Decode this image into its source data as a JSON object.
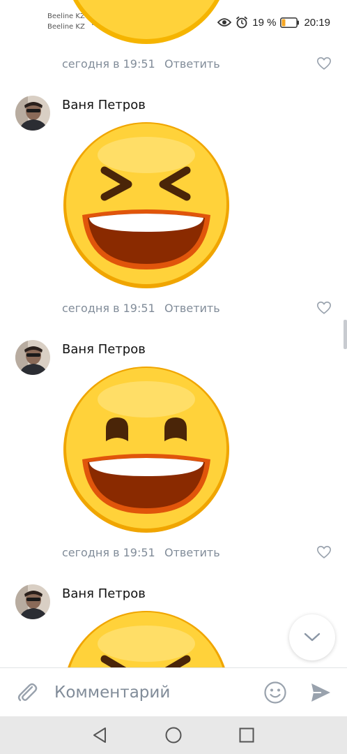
{
  "status_bar": {
    "carrier_1": "Beeline KZ",
    "carrier_2": "Beeline KZ",
    "battery": "19 %",
    "time": "20:19"
  },
  "comments": [
    {
      "author": "",
      "time": "сегодня в 19:51",
      "reply_label": "Ответить",
      "sticker": "grinning-face"
    },
    {
      "author": "Ваня Петров",
      "time": "сегодня в 19:51",
      "reply_label": "Ответить",
      "sticker": "laughing-squint-face"
    },
    {
      "author": "Ваня Петров",
      "time": "сегодня в 19:51",
      "reply_label": "Ответить",
      "sticker": "grinning-smiling-eyes-face"
    },
    {
      "author": "Ваня Петров",
      "time": "",
      "reply_label": "",
      "sticker": "laughing-squint-face"
    }
  ],
  "input_bar": {
    "placeholder": "Комментарий"
  },
  "colors": {
    "accent": "#5181b8",
    "meta_text": "#818c99",
    "emoji_yellow": "#ffd23a",
    "emoji_rim": "#f0a500",
    "mouth": "#8a2a00"
  }
}
